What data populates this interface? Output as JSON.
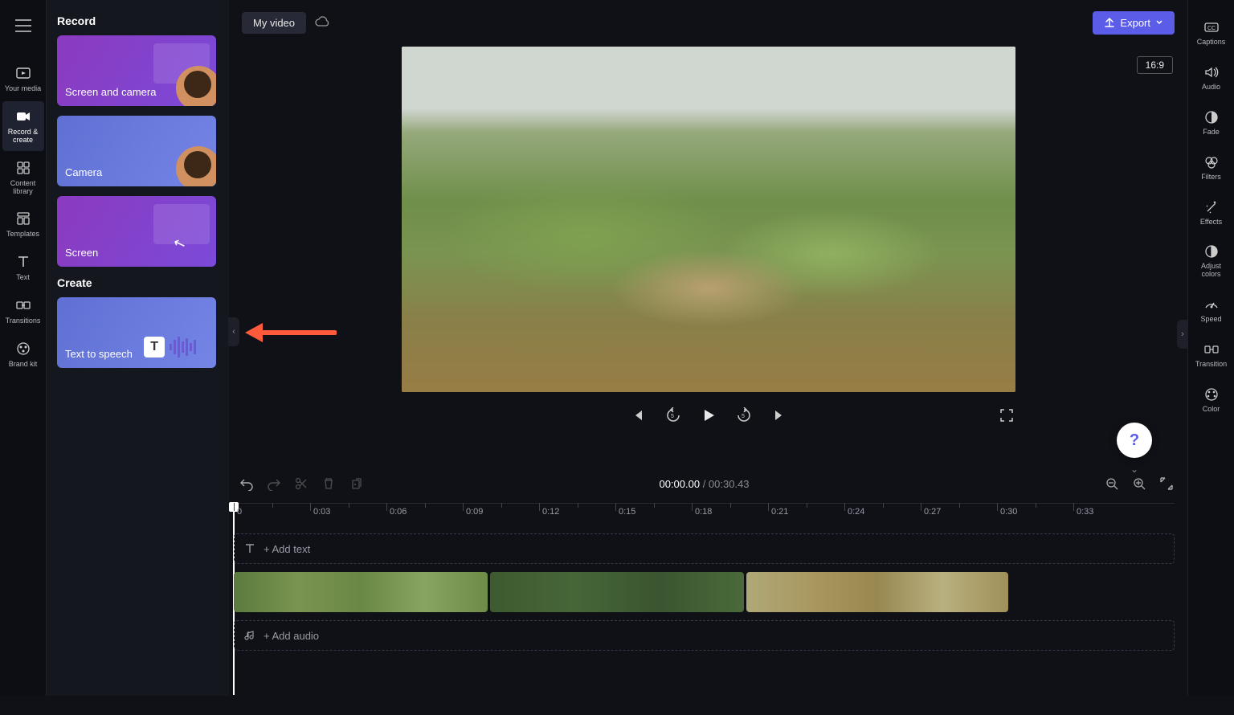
{
  "header": {
    "title": "My video",
    "export_label": "Export",
    "aspect_ratio": "16:9"
  },
  "left_nav": {
    "items": [
      {
        "label": "Your media",
        "icon": "media-icon"
      },
      {
        "label": "Record & create",
        "icon": "record-icon"
      },
      {
        "label": "Content library",
        "icon": "library-icon"
      },
      {
        "label": "Templates",
        "icon": "templates-icon"
      },
      {
        "label": "Text",
        "icon": "text-icon"
      },
      {
        "label": "Transitions",
        "icon": "transitions-icon"
      },
      {
        "label": "Brand kit",
        "icon": "brand-icon"
      }
    ]
  },
  "record_panel": {
    "heading_record": "Record",
    "heading_create": "Create",
    "cards": {
      "screen_camera": "Screen and camera",
      "camera": "Camera",
      "screen": "Screen",
      "tts": "Text to speech"
    }
  },
  "player": {
    "current_time": "00:00.00",
    "separator": " / ",
    "duration": "00:30.43"
  },
  "timeline": {
    "ticks": [
      "0",
      "0:03",
      "0:06",
      "0:09",
      "0:12",
      "0:15",
      "0:18",
      "0:21",
      "0:24",
      "0:27",
      "0:30",
      "0:33"
    ],
    "add_text": "+ Add text",
    "add_audio": "+ Add audio"
  },
  "right_rail": {
    "items": [
      {
        "label": "Captions"
      },
      {
        "label": "Audio"
      },
      {
        "label": "Fade"
      },
      {
        "label": "Filters"
      },
      {
        "label": "Effects"
      },
      {
        "label": "Adjust colors"
      },
      {
        "label": "Speed"
      },
      {
        "label": "Transition"
      },
      {
        "label": "Color"
      }
    ]
  }
}
